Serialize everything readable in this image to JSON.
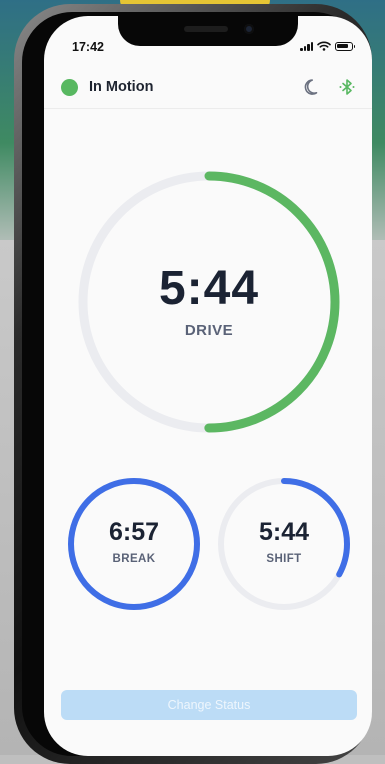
{
  "status_bar": {
    "time": "17:42"
  },
  "header": {
    "status_label": "In Motion",
    "status_color": "#58b861"
  },
  "drive": {
    "value": "5:44",
    "label": "DRIVE",
    "progress": 0.5,
    "color": "#5cb762"
  },
  "break": {
    "value": "6:57",
    "label": "BREAK",
    "progress": 1.0,
    "color": "#3f6ee6"
  },
  "shift": {
    "value": "5:44",
    "label": "SHIFT",
    "progress": 0.33,
    "color": "#3f6ee6"
  },
  "track_color": "#ebecf0",
  "actions": {
    "change_status_label": "Change Status"
  }
}
